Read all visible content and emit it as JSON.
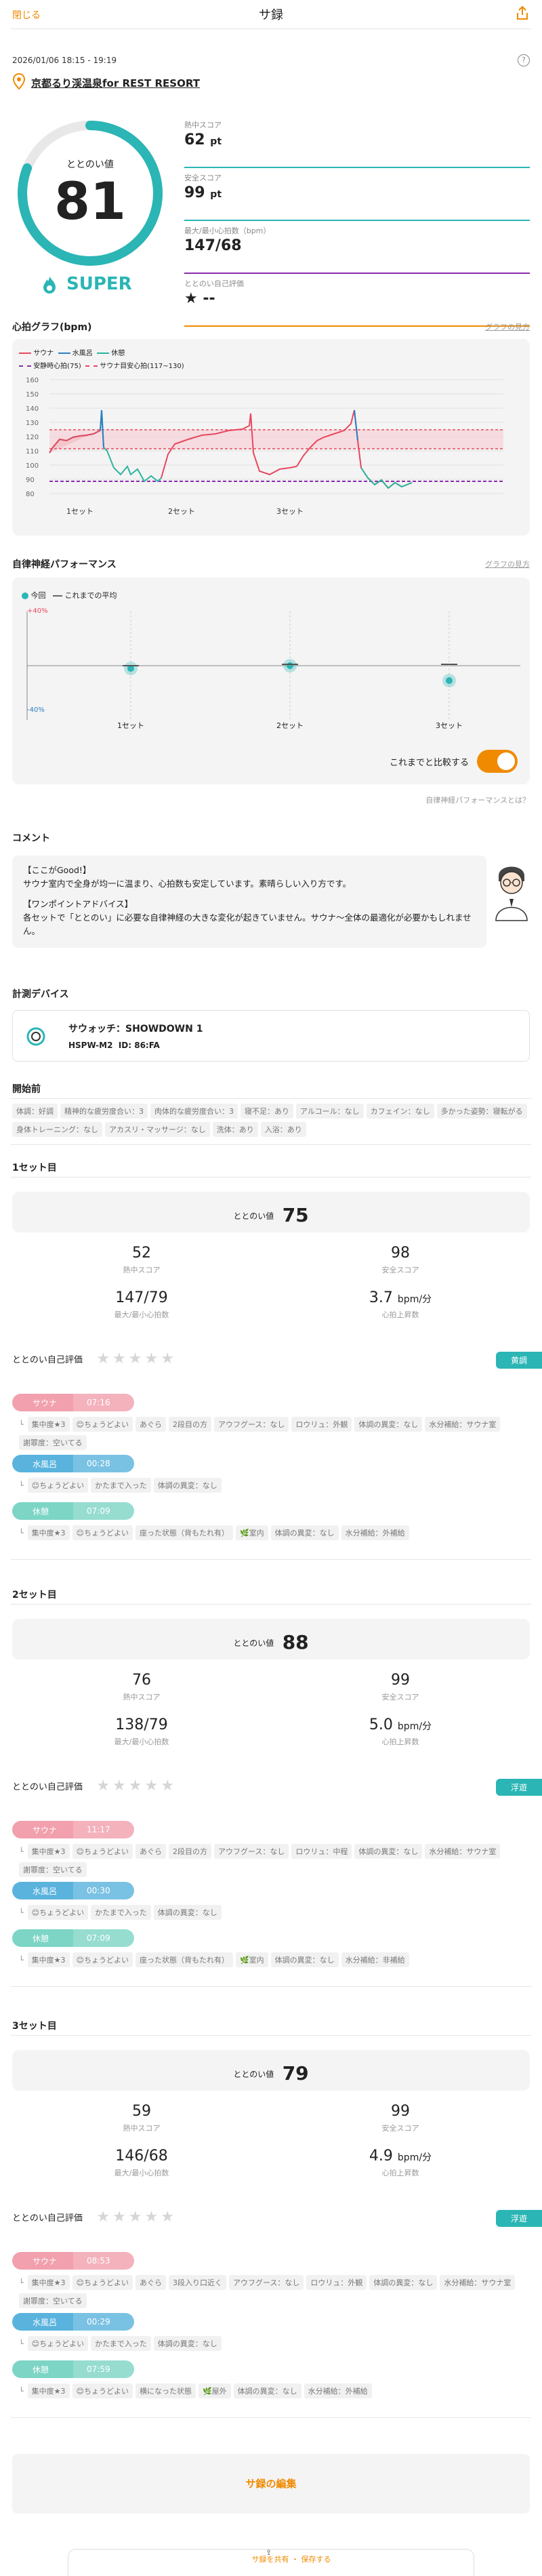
{
  "header": {
    "close": "閉じる",
    "title": "サ録"
  },
  "visit": {
    "datetime": "2026/01/06 18:15 - 19:19",
    "facility": "京都るり渓温泉for REST RESORT",
    "help": "?"
  },
  "overall": {
    "label": "ととのい値",
    "score": "81",
    "rank": "SUPER",
    "gauge_fraction": 0.81,
    "metrics": [
      {
        "label": "熱中スコア",
        "value": "62",
        "unit": "pt"
      },
      {
        "label": "安全スコア",
        "value": "99",
        "unit": "pt"
      },
      {
        "label": "最大/最小心拍数（bpm）",
        "value": "147/68",
        "unit": ""
      },
      {
        "label": "ととのい自己評価",
        "value": "★ --",
        "unit": ""
      }
    ]
  },
  "heart_chart": {
    "title": "心拍グラフ(bpm)",
    "link": "グラフの見方",
    "legend": [
      "サウナ",
      "水風呂",
      "休憩",
      "安静時心拍(75)",
      "サウナ目安心拍(117~130)"
    ],
    "colors": {
      "sauna": "#e8475f",
      "water": "#2c7fc2",
      "rest": "#2bb5a0",
      "resting": "#8a2bb0",
      "target": "#e8475f"
    },
    "yticks": [
      "160",
      "150",
      "140",
      "130",
      "120",
      "110",
      "100",
      "90",
      "80"
    ],
    "xticks": [
      "1セット",
      "2セット",
      "3セット"
    ]
  },
  "autonomic": {
    "title": "自律神経パフォーマンス",
    "link": "グラフの見方",
    "legend_now": "今回",
    "legend_avg": "これまでの平均",
    "ymax": "+40%",
    "ymin": "-40%",
    "xticks": [
      "1セット",
      "2セット",
      "3セット"
    ],
    "compare_label": "これまでと比較する",
    "footer_link": "自律神経パフォーマンスとは？"
  },
  "comment": {
    "title": "コメント",
    "good_heading": "【ここがGood!】",
    "good_text": "サウナ室内で全身が均一に温まり、心拍数も安定しています。素晴らしい入り方です。",
    "advice_heading": "【ワンポイントアドバイス】",
    "advice_text": "各セットで「ととのい」に必要な自律神経の大きな変化が起きていません。サウナ〜全体の最適化が必要かもしれません。"
  },
  "device": {
    "title": "計測デバイス",
    "name": "サウォッチ：SHOWDOWN 1",
    "model": "HSPW-M2",
    "id_label": "ID: 86:FA"
  },
  "pre_conditions": {
    "title": "開始前",
    "tags": [
      "体調：好調",
      "精神的な疲労度合い：3",
      "肉体的な疲労度合い：3",
      "寝不足：あり",
      "アルコール：なし",
      "カフェイン：なし",
      "多かった姿勢：寝転がる",
      "身体トレーニング：なし",
      "アカスリ・マッサージ：なし",
      "洗体：あり",
      "入浴：あり"
    ]
  },
  "sets": [
    {
      "title": "1セット目",
      "score_label": "ととのい値",
      "score": "75",
      "heat": "52",
      "heat_label": "熱中スコア",
      "safe": "98",
      "safe_label": "安全スコア",
      "hr": "147/79",
      "hr_label": "最大/最小心拍数",
      "rise": "3.7",
      "rise_unit": "bpm/分",
      "rise_label": "心拍上昇数",
      "self_eval_label": "ととのい自己評価",
      "badge": "黄調",
      "segments": [
        {
          "name": "サウナ",
          "time": "07:16",
          "color": "#f2a0ad",
          "tags": [
            "集中度★3",
            "😊ちょうどよい",
            "あぐら",
            "2段目の方",
            "アウフグース：なし",
            "ロウリュ：外観",
            "体調の異変：なし",
            "水分補給：サウナ室",
            "謝罪度：空いてる"
          ]
        },
        {
          "name": "水風呂",
          "time": "00:28",
          "color": "#5ab3dd",
          "tags": [
            "😊ちょうどよい",
            "かたまで入った",
            "体調の異変：なし"
          ]
        },
        {
          "name": "休憩",
          "time": "07:09",
          "color": "#7cd5c5",
          "tags": [
            "集中度★3",
            "😊ちょうどよい",
            "座った状態（背もたれ有）",
            "🌿室内",
            "体調の異変：なし",
            "水分補給：外補給"
          ]
        }
      ]
    },
    {
      "title": "2セット目",
      "score_label": "ととのい値",
      "score": "88",
      "heat": "76",
      "heat_label": "熱中スコア",
      "safe": "99",
      "safe_label": "安全スコア",
      "hr": "138/79",
      "hr_label": "最大/最小心拍数",
      "rise": "5.0",
      "rise_unit": "bpm/分",
      "rise_label": "心拍上昇数",
      "self_eval_label": "ととのい自己評価",
      "badge": "浮遊",
      "segments": [
        {
          "name": "サウナ",
          "time": "11:17",
          "color": "#f2a0ad",
          "tags": [
            "集中度★3",
            "😊ちょうどよい",
            "あぐら",
            "2段目の方",
            "アウフグース：なし",
            "ロウリュ：中程",
            "体調の異変：なし",
            "水分補給：サウナ室",
            "謝罪度：空いてる"
          ]
        },
        {
          "name": "水風呂",
          "time": "00:30",
          "color": "#5ab3dd",
          "tags": [
            "😊ちょうどよい",
            "かたまで入った",
            "体調の異変：なし"
          ]
        },
        {
          "name": "休憩",
          "time": "07:09",
          "color": "#7cd5c5",
          "tags": [
            "集中度★3",
            "😊ちょうどよい",
            "座った状態（背もたれ有）",
            "🌿室内",
            "体調の異変：なし",
            "水分補給：非補給"
          ]
        }
      ]
    },
    {
      "title": "3セット目",
      "score_label": "ととのい値",
      "score": "79",
      "heat": "59",
      "heat_label": "熱中スコア",
      "safe": "99",
      "safe_label": "安全スコア",
      "hr": "146/68",
      "hr_label": "最大/最小心拍数",
      "rise": "4.9",
      "rise_unit": "bpm/分",
      "rise_label": "心拍上昇数",
      "self_eval_label": "ととのい自己評価",
      "badge": "浮遊",
      "segments": [
        {
          "name": "サウナ",
          "time": "08:53",
          "color": "#f2a0ad",
          "tags": [
            "集中度★3",
            "😊ちょうどよい",
            "あぐら",
            "3段入り口近く",
            "アウフグース：なし",
            "ロウリュ：外観",
            "体調の異変：なし",
            "水分補給：サウナ室",
            "謝罪度：空いてる"
          ]
        },
        {
          "name": "水風呂",
          "time": "00:29",
          "color": "#5ab3dd",
          "tags": [
            "😊ちょうどよい",
            "かたまで入った",
            "体調の異変：なし"
          ]
        },
        {
          "name": "休憩",
          "time": "07:59",
          "color": "#7cd5c5",
          "tags": [
            "集中度★3",
            "😊ちょうどよい",
            "横になった状態",
            "🌿屋外",
            "体調の異変：なし",
            "水分補給：外補給"
          ]
        }
      ]
    }
  ],
  "edit_button": "サ録の編集",
  "footer_hint": "サ録を共有 ・ 保存する"
}
